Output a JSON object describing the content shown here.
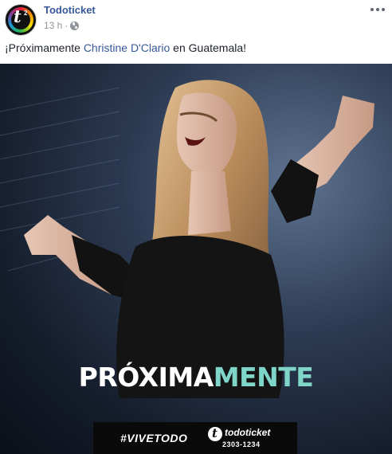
{
  "post": {
    "page_name": "Todoticket",
    "time": "13 h",
    "separator": "·",
    "privacy_icon": "globe-icon",
    "menu_icon": "more-horizontal-icon",
    "text": {
      "prefix": "¡Próximamente ",
      "mention": "Christine D'Clario",
      "suffix": " en Guatemala!"
    }
  },
  "avatar": {
    "letter": "t",
    "superscript": "2"
  },
  "image": {
    "headline_part1": "PRÓXIMA",
    "headline_part2": "MENTE",
    "hashtag": "#VIVETODO",
    "brand_name": "todoticket",
    "brand_phone": "2303-1234"
  },
  "colors": {
    "link": "#385898",
    "meta": "#90949c",
    "headline_accent": "#7fd6c8"
  }
}
